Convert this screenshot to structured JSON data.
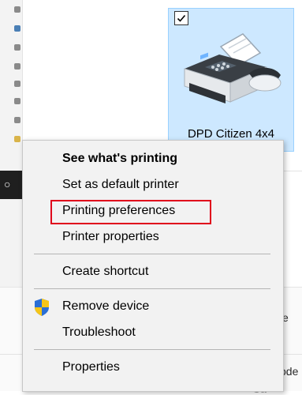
{
  "printer": {
    "name": "DPD Citizen 4x4",
    "selected": true
  },
  "menu": {
    "items": [
      {
        "label": "See what's printing",
        "bold": true
      },
      {
        "label": "Set as default printer"
      },
      {
        "label": "Printing preferences",
        "highlighted": true
      },
      {
        "label": "Printer properties"
      },
      {
        "label": "Create shortcut"
      },
      {
        "label": "Remove device",
        "icon": "uac-shield-icon"
      },
      {
        "label": "Troubleshoot"
      },
      {
        "label": "Properties"
      }
    ]
  },
  "background": {
    "peek_e": "e",
    "peek_ode": "ode",
    "peek_ca": "Ca"
  },
  "colors": {
    "tile_bg": "#cde8ff",
    "tile_border": "#99d1ff",
    "menu_bg": "#f2f2f2",
    "highlight_border": "#e0001b"
  }
}
